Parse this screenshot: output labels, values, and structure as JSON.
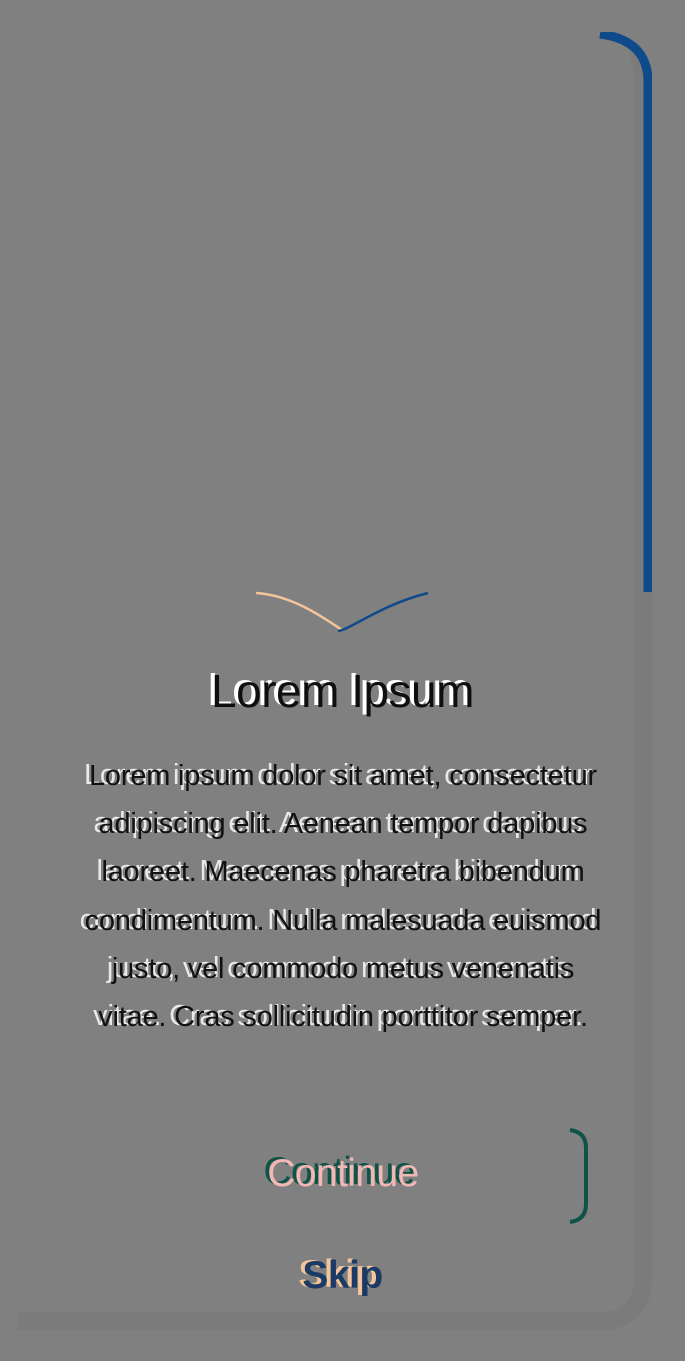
{
  "onboarding": {
    "title": "Lorem Ipsum",
    "body": "Lorem ipsum dolor sit amet, consectetur adipiscing elit. Aenean tempor dapibus laoreet. Maecenas pharetra bibendum condimentum. Nulla malesuada euismod justo, vel commodo metus venenatis vitae. Cras sollicitudin porttitor semper.",
    "continue_label": "Continue",
    "skip_label": "Skip"
  },
  "colors": {
    "background": "#808080",
    "accent_blue": "#0f4a8a",
    "accent_orange": "#f5c59a",
    "accent_teal": "#0e5346",
    "continue_text": "#f2b8b6"
  }
}
